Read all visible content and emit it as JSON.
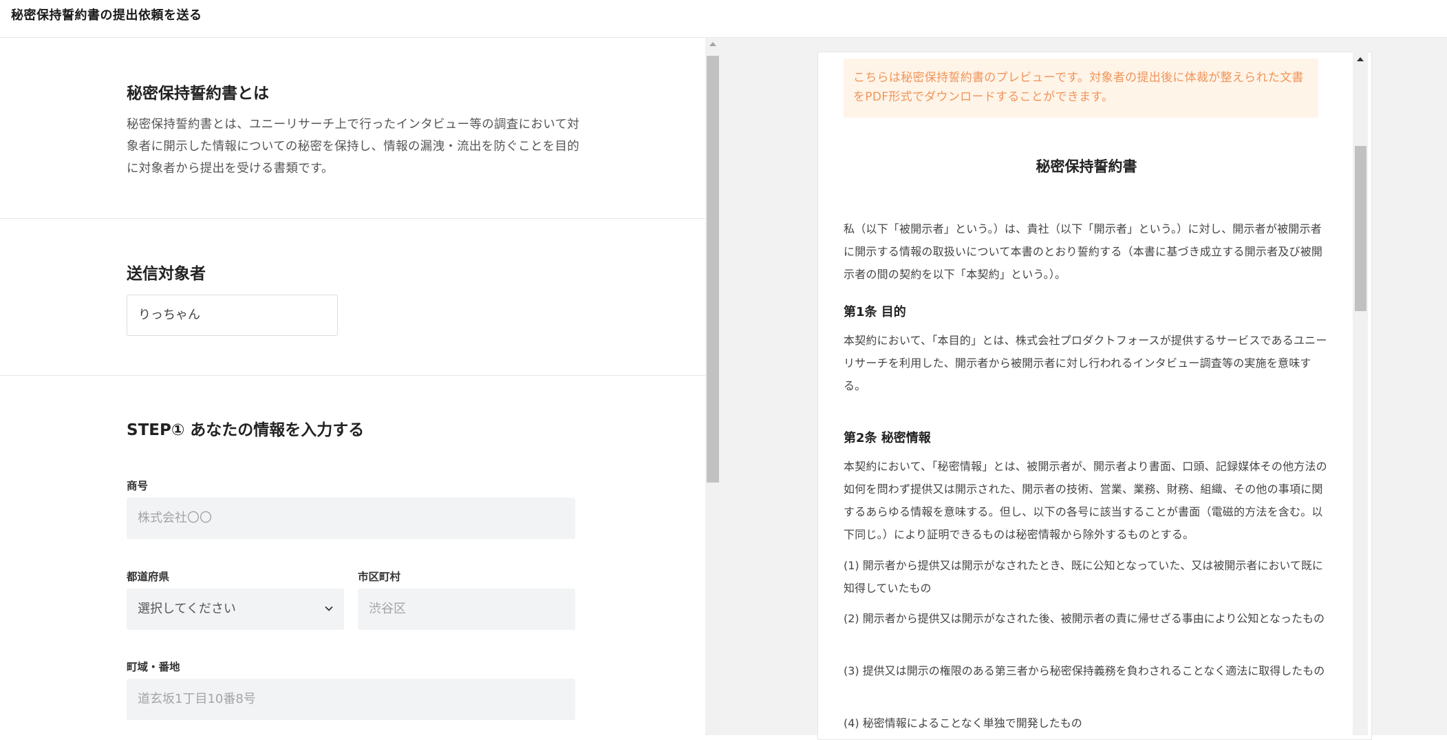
{
  "header": {
    "title": "秘密保持誓約書の提出依頼を送る"
  },
  "about": {
    "heading": "秘密保持誓約書とは",
    "description": "秘密保持誓約書とは、ユニーリサーチ上で行ったインタビュー等の調査において対象者に開示した情報についての秘密を保持し、情報の漏洩・流出を防ぐことを目的に対象者から提出を受ける書類です。"
  },
  "recipient": {
    "heading": "送信対象者",
    "name": "りっちゃん"
  },
  "step1": {
    "heading": "STEP① あなたの情報を入力する",
    "company": {
      "label": "商号",
      "placeholder": "株式会社〇〇"
    },
    "prefecture": {
      "label": "都道府県",
      "value": "選択してください"
    },
    "city": {
      "label": "市区町村",
      "placeholder": "渋谷区"
    },
    "address": {
      "label": "町域・番地",
      "placeholder": "道玄坂1丁目10番8号"
    }
  },
  "preview": {
    "notice": "こちらは秘密保持誓約書のプレビューです。対象者の提出後に体裁が整えられた文書をPDF形式でダウンロードすることができます。",
    "title": "秘密保持誓約書",
    "intro": "私（以下「被開示者」という。）は、貴社（以下「開示者」という。）に対し、開示者が被開示者に開示する情報の取扱いについて本書のとおり誓約する（本書に基づき成立する開示者及び被開示者の間の契約を以下「本契約」という。）。",
    "art1_heading": "第1条 目的",
    "art1_body": "本契約において、「本目的」とは、株式会社プロダクトフォースが提供するサービスであるユニーリサーチを利用した、開示者から被開示者に対し行われるインタビュー調査等の実施を意味する。",
    "art2_heading": "第2条 秘密情報",
    "art2_body": "本契約において、「秘密情報」とは、被開示者が、開示者より書面、口頭、記録媒体その他方法の如何を問わず提供又は開示された、開示者の技術、営業、業務、財務、組織、その他の事項に関するあらゆる情報を意味する。但し、以下の各号に該当することが書面（電磁的方法を含む。以下同じ。）により証明できるものは秘密情報から除外するものとする。",
    "items": [
      "(1) 開示者から提供又は開示がなされたとき、既に公知となっていた、又は被開示者において既に知得していたもの",
      "(2) 開示者から提供又は開示がなされた後、被開示者の責に帰せざる事由により公知となったもの",
      "(3) 提供又は開示の権限のある第三者から秘密保持義務を負わされることなく適法に取得したもの",
      "(4) 秘密情報によることなく単独で開発したもの"
    ]
  }
}
